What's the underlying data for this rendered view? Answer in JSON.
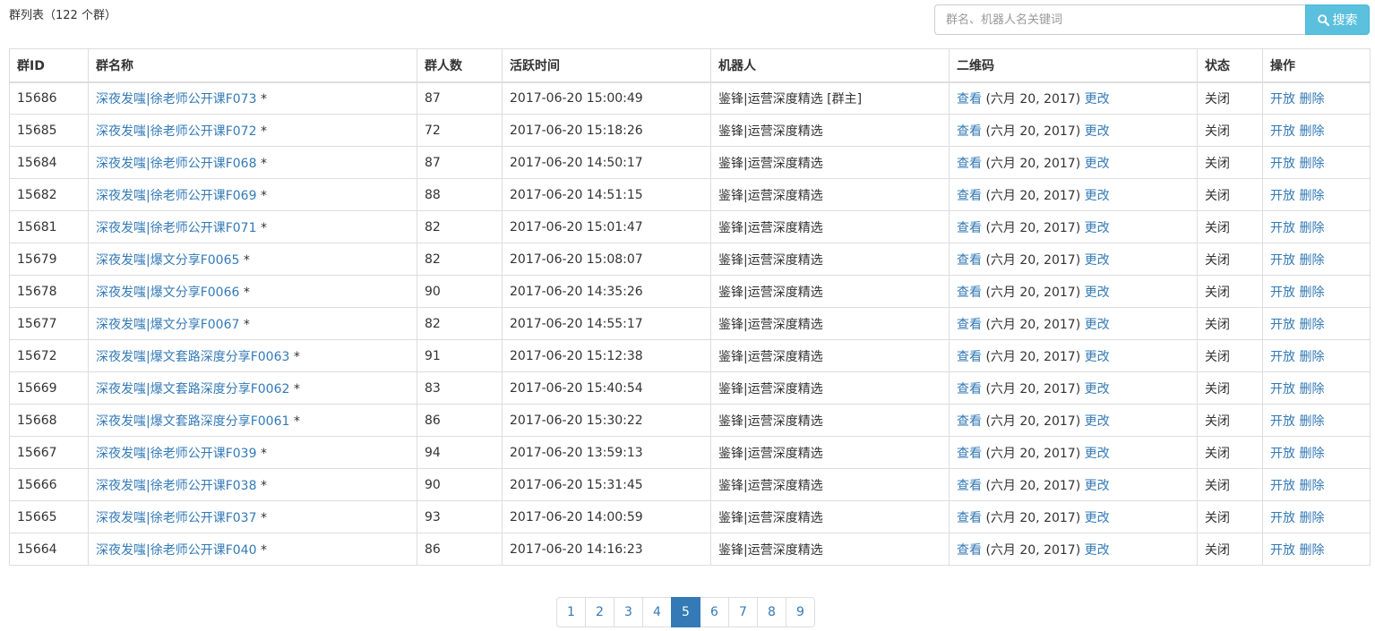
{
  "header": {
    "title": "群列表（122 个群）"
  },
  "search": {
    "placeholder": "群名、机器人名关键词",
    "value": "",
    "button_label": "搜索",
    "button_color": "#5bc0de"
  },
  "table": {
    "columns": [
      "群ID",
      "群名称",
      "群人数",
      "活跃时间",
      "机器人",
      "二维码",
      "状态",
      "操作"
    ],
    "rows": [
      {
        "id": "15686",
        "name": "深夜发嗤|徐老师公开课F073",
        "mark": " *",
        "members": "87",
        "active": "2017-06-20 15:00:49",
        "robot": "鉴锋|运营深度精选 [群主]",
        "qr_view": "查看",
        "qr_date": " (六月 20, 2017) ",
        "qr_edit": "更改",
        "status": "关闭",
        "op_open": "开放",
        "op_delete": "删除"
      },
      {
        "id": "15685",
        "name": "深夜发嗤|徐老师公开课F072",
        "mark": " *",
        "members": "72",
        "active": "2017-06-20 15:18:26",
        "robot": "鉴锋|运营深度精选",
        "qr_view": "查看",
        "qr_date": " (六月 20, 2017) ",
        "qr_edit": "更改",
        "status": "关闭",
        "op_open": "开放",
        "op_delete": "删除"
      },
      {
        "id": "15684",
        "name": "深夜发嗤|徐老师公开课F068",
        "mark": " *",
        "members": "87",
        "active": "2017-06-20 14:50:17",
        "robot": "鉴锋|运营深度精选",
        "qr_view": "查看",
        "qr_date": " (六月 20, 2017) ",
        "qr_edit": "更改",
        "status": "关闭",
        "op_open": "开放",
        "op_delete": "删除"
      },
      {
        "id": "15682",
        "name": "深夜发嗤|徐老师公开课F069",
        "mark": " *",
        "members": "88",
        "active": "2017-06-20 14:51:15",
        "robot": "鉴锋|运营深度精选",
        "qr_view": "查看",
        "qr_date": " (六月 20, 2017) ",
        "qr_edit": "更改",
        "status": "关闭",
        "op_open": "开放",
        "op_delete": "删除"
      },
      {
        "id": "15681",
        "name": "深夜发嗤|徐老师公开课F071",
        "mark": " *",
        "members": "82",
        "active": "2017-06-20 15:01:47",
        "robot": "鉴锋|运营深度精选",
        "qr_view": "查看",
        "qr_date": " (六月 20, 2017) ",
        "qr_edit": "更改",
        "status": "关闭",
        "op_open": "开放",
        "op_delete": "删除"
      },
      {
        "id": "15679",
        "name": "深夜发嗤|爆文分享F0065",
        "mark": " *",
        "members": "82",
        "active": "2017-06-20 15:08:07",
        "robot": "鉴锋|运营深度精选",
        "qr_view": "查看",
        "qr_date": " (六月 20, 2017) ",
        "qr_edit": "更改",
        "status": "关闭",
        "op_open": "开放",
        "op_delete": "删除"
      },
      {
        "id": "15678",
        "name": "深夜发嗤|爆文分享F0066",
        "mark": " *",
        "members": "90",
        "active": "2017-06-20 14:35:26",
        "robot": "鉴锋|运营深度精选",
        "qr_view": "查看",
        "qr_date": " (六月 20, 2017) ",
        "qr_edit": "更改",
        "status": "关闭",
        "op_open": "开放",
        "op_delete": "删除"
      },
      {
        "id": "15677",
        "name": "深夜发嗤|爆文分享F0067",
        "mark": " *",
        "members": "82",
        "active": "2017-06-20 14:55:17",
        "robot": "鉴锋|运营深度精选",
        "qr_view": "查看",
        "qr_date": " (六月 20, 2017) ",
        "qr_edit": "更改",
        "status": "关闭",
        "op_open": "开放",
        "op_delete": "删除"
      },
      {
        "id": "15672",
        "name": "深夜发嗤|爆文套路深度分享F0063",
        "mark": " *",
        "members": "91",
        "active": "2017-06-20 15:12:38",
        "robot": "鉴锋|运营深度精选",
        "qr_view": "查看",
        "qr_date": " (六月 20, 2017) ",
        "qr_edit": "更改",
        "status": "关闭",
        "op_open": "开放",
        "op_delete": "删除"
      },
      {
        "id": "15669",
        "name": "深夜发嗤|爆文套路深度分享F0062",
        "mark": " *",
        "members": "83",
        "active": "2017-06-20 15:40:54",
        "robot": "鉴锋|运营深度精选",
        "qr_view": "查看",
        "qr_date": " (六月 20, 2017) ",
        "qr_edit": "更改",
        "status": "关闭",
        "op_open": "开放",
        "op_delete": "删除"
      },
      {
        "id": "15668",
        "name": "深夜发嗤|爆文套路深度分享F0061",
        "mark": " *",
        "members": "86",
        "active": "2017-06-20 15:30:22",
        "robot": "鉴锋|运营深度精选",
        "qr_view": "查看",
        "qr_date": " (六月 20, 2017) ",
        "qr_edit": "更改",
        "status": "关闭",
        "op_open": "开放",
        "op_delete": "删除"
      },
      {
        "id": "15667",
        "name": "深夜发嗤|徐老师公开课F039",
        "mark": " *",
        "members": "94",
        "active": "2017-06-20 13:59:13",
        "robot": "鉴锋|运营深度精选",
        "qr_view": "查看",
        "qr_date": " (六月 20, 2017) ",
        "qr_edit": "更改",
        "status": "关闭",
        "op_open": "开放",
        "op_delete": "删除"
      },
      {
        "id": "15666",
        "name": "深夜发嗤|徐老师公开课F038",
        "mark": " *",
        "members": "90",
        "active": "2017-06-20 15:31:45",
        "robot": "鉴锋|运营深度精选",
        "qr_view": "查看",
        "qr_date": " (六月 20, 2017) ",
        "qr_edit": "更改",
        "status": "关闭",
        "op_open": "开放",
        "op_delete": "删除"
      },
      {
        "id": "15665",
        "name": "深夜发嗤|徐老师公开课F037",
        "mark": " *",
        "members": "93",
        "active": "2017-06-20 14:00:59",
        "robot": "鉴锋|运营深度精选",
        "qr_view": "查看",
        "qr_date": " (六月 20, 2017) ",
        "qr_edit": "更改",
        "status": "关闭",
        "op_open": "开放",
        "op_delete": "删除"
      },
      {
        "id": "15664",
        "name": "深夜发嗤|徐老师公开课F040",
        "mark": " *",
        "members": "86",
        "active": "2017-06-20 14:16:23",
        "robot": "鉴锋|运营深度精选",
        "qr_view": "查看",
        "qr_date": " (六月 20, 2017) ",
        "qr_edit": "更改",
        "status": "关闭",
        "op_open": "开放",
        "op_delete": "删除"
      }
    ]
  },
  "pagination": {
    "pages": [
      "1",
      "2",
      "3",
      "4",
      "5",
      "6",
      "7",
      "8",
      "9"
    ],
    "current": "5",
    "accent_color": "#337ab7"
  }
}
